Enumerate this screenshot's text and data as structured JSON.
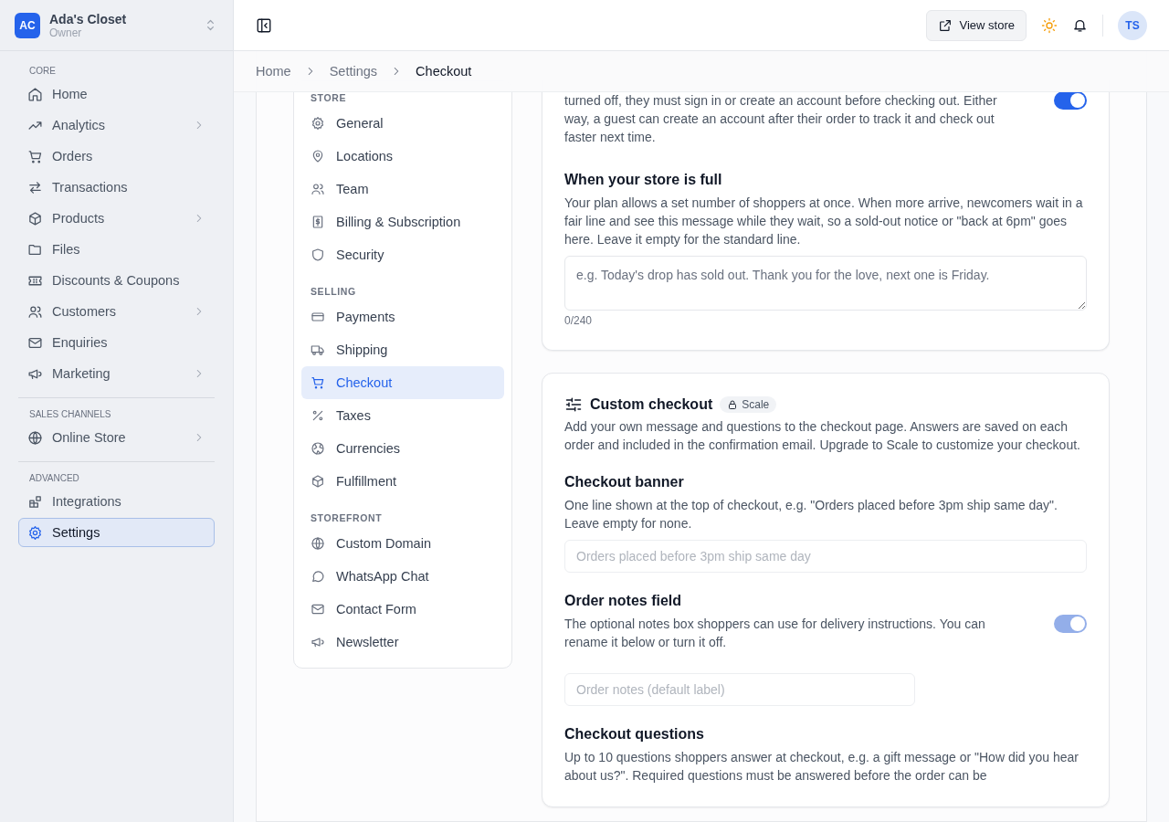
{
  "sidebar": {
    "store": {
      "initials": "AC",
      "name": "Ada's Closet",
      "role": "Owner"
    },
    "sections": [
      {
        "label": "CORE",
        "items": [
          {
            "label": "Home",
            "expandable": false,
            "selected": false
          },
          {
            "label": "Analytics",
            "expandable": true,
            "selected": false
          },
          {
            "label": "Orders",
            "expandable": false,
            "selected": false
          },
          {
            "label": "Transactions",
            "expandable": false,
            "selected": false
          },
          {
            "label": "Products",
            "expandable": true,
            "selected": false
          },
          {
            "label": "Files",
            "expandable": false,
            "selected": false
          },
          {
            "label": "Discounts & Coupons",
            "expandable": false,
            "selected": false
          },
          {
            "label": "Customers",
            "expandable": true,
            "selected": false
          },
          {
            "label": "Enquiries",
            "expandable": false,
            "selected": false
          },
          {
            "label": "Marketing",
            "expandable": true,
            "selected": false
          }
        ]
      },
      {
        "label": "SALES CHANNELS",
        "items": [
          {
            "label": "Online Store",
            "expandable": true,
            "selected": false
          }
        ]
      },
      {
        "label": "ADVANCED",
        "items": [
          {
            "label": "Integrations",
            "expandable": false,
            "selected": false
          },
          {
            "label": "Settings",
            "expandable": false,
            "selected": true
          }
        ]
      }
    ]
  },
  "header": {
    "view_store": "View store",
    "avatar": "TS"
  },
  "breadcrumb": [
    "Home",
    "Settings",
    "Checkout"
  ],
  "settings_nav": {
    "sections": [
      {
        "label": "STORE",
        "items": [
          {
            "label": "General",
            "selected": false
          },
          {
            "label": "Locations",
            "selected": false
          },
          {
            "label": "Team",
            "selected": false
          },
          {
            "label": "Billing & Subscription",
            "selected": false
          },
          {
            "label": "Security",
            "selected": false
          }
        ]
      },
      {
        "label": "SELLING",
        "items": [
          {
            "label": "Payments",
            "selected": false
          },
          {
            "label": "Shipping",
            "selected": false
          },
          {
            "label": "Checkout",
            "selected": true
          },
          {
            "label": "Taxes",
            "selected": false
          },
          {
            "label": "Currencies",
            "selected": false
          },
          {
            "label": "Fulfillment",
            "selected": false
          }
        ]
      },
      {
        "label": "STOREFRONT",
        "items": [
          {
            "label": "Custom Domain",
            "selected": false
          },
          {
            "label": "WhatsApp Chat",
            "selected": false
          },
          {
            "label": "Contact Form",
            "selected": false
          },
          {
            "label": "Newsletter",
            "selected": false
          }
        ]
      }
    ]
  },
  "guest_checkout": {
    "description": "turned off, they must sign in or create an account before checking out. Either way, a guest can create an account after their order to track it and check out faster next time.",
    "toggle": {
      "on": true,
      "disabled": false
    }
  },
  "store_full": {
    "title": "When your store is full",
    "description": "Your plan allows a set number of shoppers at once. When more arrive, newcomers wait in a fair line and see this message while they wait, so a sold-out notice or \"back at 6pm\" goes here. Leave it empty for the standard line.",
    "textarea": {
      "placeholder": "e.g. Today's drop has sold out. Thank you for the love, next one is Friday."
    },
    "counter": "0/240"
  },
  "custom_checkout": {
    "title": "Custom checkout",
    "badge": "Scale",
    "description": "Add your own message and questions to the checkout page. Answers are saved on each order and included in the confirmation email. Upgrade to Scale to customize your checkout.",
    "fields": [
      {
        "kind": "input",
        "title": "Checkout banner",
        "description": "One line shown at the top of checkout, e.g. \"Orders placed before 3pm ship same day\". Leave empty for none.",
        "placeholder": "Orders placed before 3pm ship same day",
        "disabled": true
      },
      {
        "kind": "toggle",
        "title": "Order notes field",
        "description": "The optional notes box shoppers can use for delivery instructions. You can rename it below or turn it off.",
        "toggle": {
          "on": true,
          "disabled": true
        },
        "placeholder": "Order notes (default label)",
        "disabled": true
      },
      {
        "kind": "heading",
        "title": "Checkout questions",
        "description": "Up to 10 questions shoppers answer at checkout, e.g. a gift message or \"How did you hear about us?\". Required questions must be answered before the order can be"
      }
    ]
  }
}
